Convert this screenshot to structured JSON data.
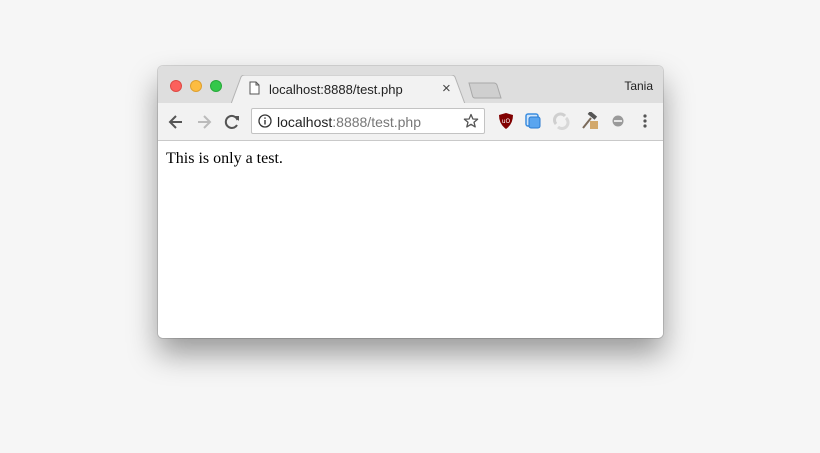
{
  "window": {
    "profile_name": "Tania",
    "tab": {
      "title": "localhost:8888/test.php",
      "close_glyph": "×"
    },
    "address_bar": {
      "host": "localhost",
      "path": ":8888/test.php"
    },
    "extensions": [
      "ublock-origin-icon",
      "cast-icon",
      "sync-icon",
      "hammer-icon",
      "extension-icon"
    ],
    "colors": {
      "close": "#fc605c",
      "minimize": "#fdbc40",
      "maximize": "#34c84a",
      "ublock": "#800000"
    }
  },
  "page": {
    "text": "This is only a test."
  }
}
